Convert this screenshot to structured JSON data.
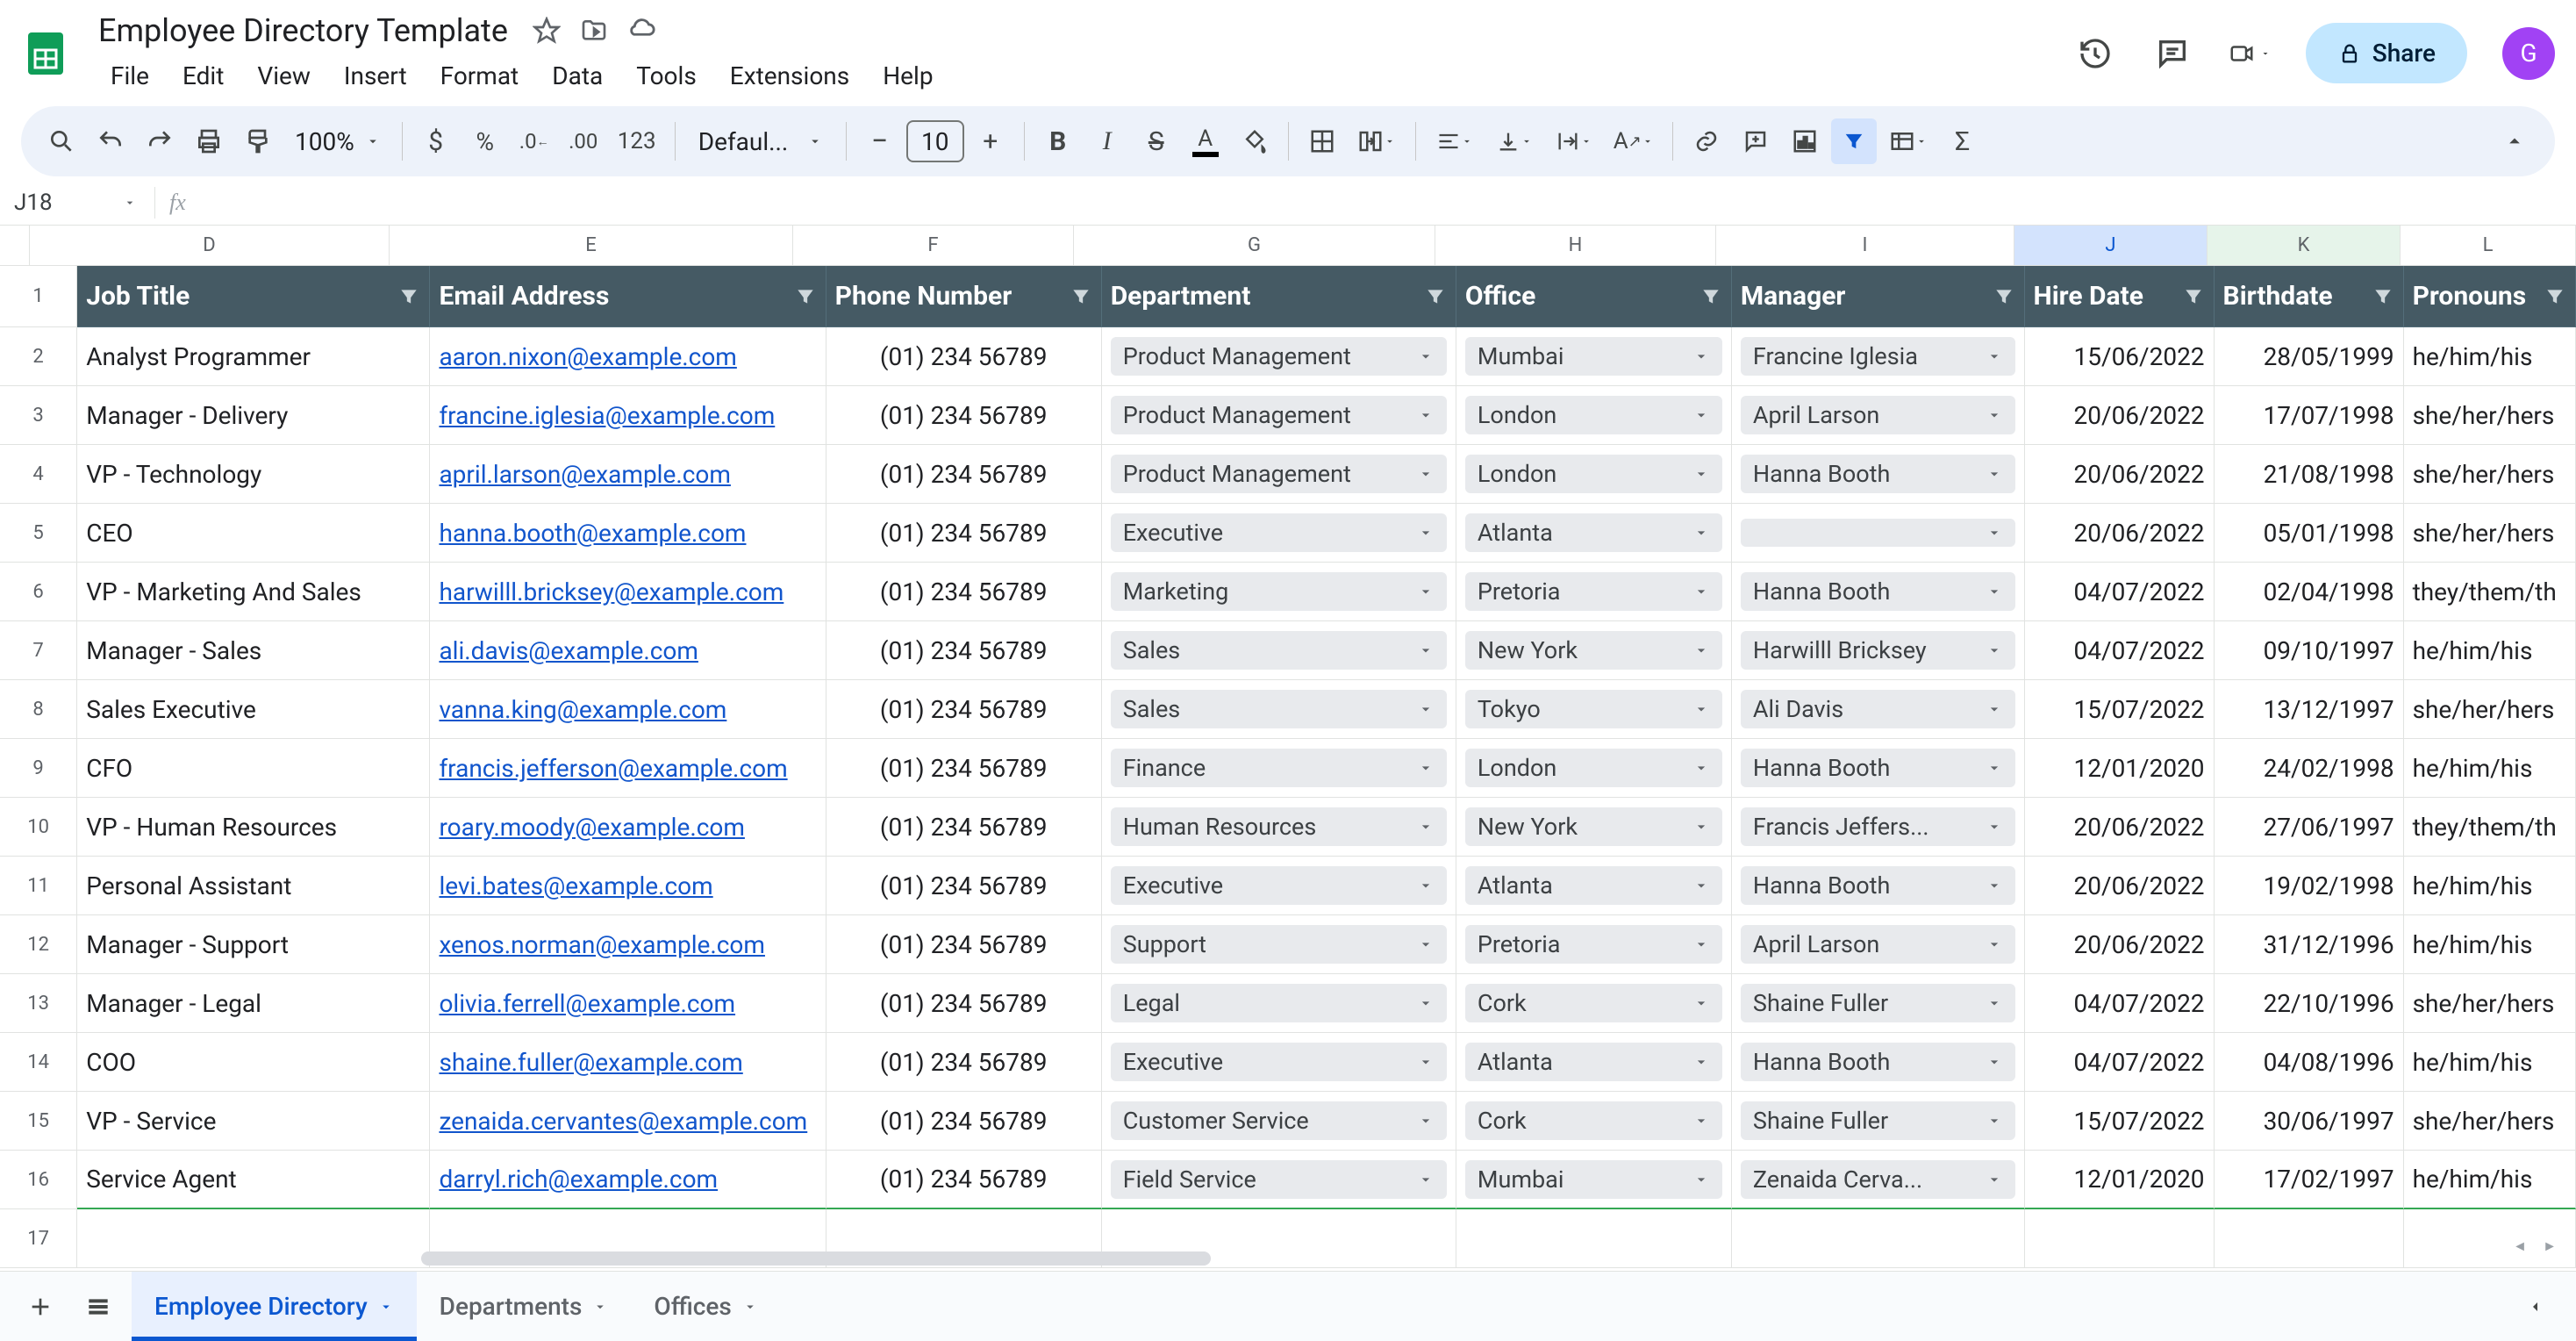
{
  "doc": {
    "title": "Employee Directory Template"
  },
  "menus": [
    "File",
    "Edit",
    "View",
    "Insert",
    "Format",
    "Data",
    "Tools",
    "Extensions",
    "Help"
  ],
  "share_label": "Share",
  "avatar_letter": "G",
  "zoom": "100%",
  "font_name": "Defaul...",
  "font_size": "10",
  "numfmt_123": "123",
  "namebox": "J18",
  "columns": [
    {
      "letter": "D",
      "width": "c-D"
    },
    {
      "letter": "E",
      "width": "c-E"
    },
    {
      "letter": "F",
      "width": "c-F"
    },
    {
      "letter": "G",
      "width": "c-G"
    },
    {
      "letter": "H",
      "width": "c-H"
    },
    {
      "letter": "I",
      "width": "c-I"
    },
    {
      "letter": "J",
      "width": "c-J",
      "sel": true
    },
    {
      "letter": "K",
      "width": "c-K"
    },
    {
      "letter": "L",
      "width": "c-L"
    }
  ],
  "headers": [
    "Job Title",
    "Email Address",
    "Phone Number",
    "Department",
    "Office",
    "Manager",
    "Hire Date",
    "Birthdate",
    "Pronouns"
  ],
  "rows": [
    {
      "n": 2,
      "title": "Analyst Programmer",
      "email": "aaron.nixon@example.com",
      "phone": "(01) 234 56789",
      "dept": "Product Management",
      "office": "Mumbai",
      "mgr": "Francine Iglesia",
      "hire": "15/06/2022",
      "birth": "28/05/1999",
      "pro": "he/him/his"
    },
    {
      "n": 3,
      "title": "Manager - Delivery",
      "email": "francine.iglesia@example.com",
      "phone": "(01) 234 56789",
      "dept": "Product Management",
      "office": "London",
      "mgr": "April Larson",
      "hire": "20/06/2022",
      "birth": "17/07/1998",
      "pro": "she/her/hers"
    },
    {
      "n": 4,
      "title": "VP - Technology",
      "email": "april.larson@example.com",
      "phone": "(01) 234 56789",
      "dept": "Product Management",
      "office": "London",
      "mgr": "Hanna Booth",
      "hire": "20/06/2022",
      "birth": "21/08/1998",
      "pro": "she/her/hers"
    },
    {
      "n": 5,
      "title": "CEO",
      "email": "hanna.booth@example.com",
      "phone": "(01) 234 56789",
      "dept": "Executive",
      "office": "Atlanta",
      "mgr": "",
      "hire": "20/06/2022",
      "birth": "05/01/1998",
      "pro": "she/her/hers"
    },
    {
      "n": 6,
      "title": "VP - Marketing And Sales",
      "email": "harwilll.bricksey@example.com",
      "phone": "(01) 234 56789",
      "dept": "Marketing",
      "office": "Pretoria",
      "mgr": "Hanna Booth",
      "hire": "04/07/2022",
      "birth": "02/04/1998",
      "pro": "they/them/th"
    },
    {
      "n": 7,
      "title": "Manager - Sales",
      "email": "ali.davis@example.com",
      "phone": "(01) 234 56789",
      "dept": "Sales",
      "office": "New York",
      "mgr": "Harwilll Bricksey",
      "hire": "04/07/2022",
      "birth": "09/10/1997",
      "pro": "he/him/his"
    },
    {
      "n": 8,
      "title": "Sales Executive",
      "email": "vanna.king@example.com",
      "phone": "(01) 234 56789",
      "dept": "Sales",
      "office": "Tokyo",
      "mgr": "Ali Davis",
      "hire": "15/07/2022",
      "birth": "13/12/1997",
      "pro": "she/her/hers"
    },
    {
      "n": 9,
      "title": "CFO",
      "email": "francis.jefferson@example.com",
      "phone": "(01) 234 56789",
      "dept": "Finance",
      "office": "London",
      "mgr": "Hanna Booth",
      "hire": "12/01/2020",
      "birth": "24/02/1998",
      "pro": "he/him/his"
    },
    {
      "n": 10,
      "title": "VP - Human Resources",
      "email": "roary.moody@example.com",
      "phone": "(01) 234 56789",
      "dept": "Human Resources",
      "office": "New York",
      "mgr": "Francis Jeffers...",
      "hire": "20/06/2022",
      "birth": "27/06/1997",
      "pro": "they/them/th"
    },
    {
      "n": 11,
      "title": "Personal Assistant",
      "email": "levi.bates@example.com",
      "phone": "(01) 234 56789",
      "dept": "Executive",
      "office": "Atlanta",
      "mgr": "Hanna Booth",
      "hire": "20/06/2022",
      "birth": "19/02/1998",
      "pro": "he/him/his"
    },
    {
      "n": 12,
      "title": "Manager - Support",
      "email": "xenos.norman@example.com",
      "phone": "(01) 234 56789",
      "dept": "Support",
      "office": "Pretoria",
      "mgr": "April Larson",
      "hire": "20/06/2022",
      "birth": "31/12/1996",
      "pro": "he/him/his"
    },
    {
      "n": 13,
      "title": "Manager - Legal",
      "email": "olivia.ferrell@example.com",
      "phone": "(01) 234 56789",
      "dept": "Legal",
      "office": "Cork",
      "mgr": "Shaine Fuller",
      "hire": "04/07/2022",
      "birth": "22/10/1996",
      "pro": "she/her/hers"
    },
    {
      "n": 14,
      "title": "COO",
      "email": "shaine.fuller@example.com",
      "phone": "(01) 234 56789",
      "dept": "Executive",
      "office": "Atlanta",
      "mgr": "Hanna Booth",
      "hire": "04/07/2022",
      "birth": "04/08/1996",
      "pro": "he/him/his"
    },
    {
      "n": 15,
      "title": "VP - Service",
      "email": "zenaida.cervantes@example.com",
      "phone": "(01) 234 56789",
      "dept": "Customer Service",
      "office": "Cork",
      "mgr": "Shaine Fuller",
      "hire": "15/07/2022",
      "birth": "30/06/1997",
      "pro": "she/her/hers"
    },
    {
      "n": 16,
      "title": "Service Agent",
      "email": "darryl.rich@example.com",
      "phone": "(01) 234 56789",
      "dept": "Field Service",
      "office": "Mumbai",
      "mgr": "Zenaida Cerva...",
      "hire": "12/01/2020",
      "birth": "17/02/1997",
      "pro": "he/him/his"
    }
  ],
  "empty_row": 17,
  "tabs": [
    {
      "label": "Employee Directory",
      "active": true
    },
    {
      "label": "Departments",
      "active": false
    },
    {
      "label": "Offices",
      "active": false
    }
  ]
}
